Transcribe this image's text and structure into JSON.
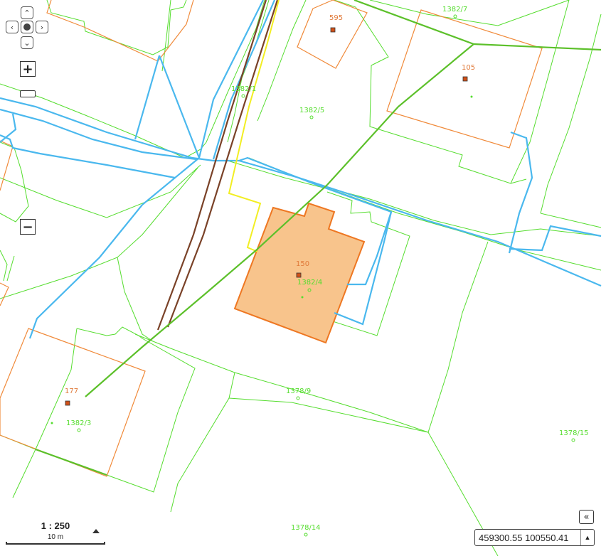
{
  "map": {
    "parcels": [
      {
        "id": "p1",
        "label": "1382/7"
      },
      {
        "id": "p2",
        "label": "1382/1"
      },
      {
        "id": "p3",
        "label": "1382/5"
      },
      {
        "id": "p4",
        "label": "1382/4"
      },
      {
        "id": "p5",
        "label": "1378/9"
      },
      {
        "id": "p6",
        "label": "1382/3"
      },
      {
        "id": "p7",
        "label": "1378/15"
      },
      {
        "id": "p8",
        "label": "1378/14"
      }
    ],
    "buildings": [
      {
        "id": "b1",
        "label": "595"
      },
      {
        "id": "b2",
        "label": "105"
      },
      {
        "id": "b3",
        "label": "150",
        "selected": true
      },
      {
        "id": "b4",
        "label": "177"
      }
    ],
    "colors": {
      "parcel_line": "#55dd2e",
      "building_line": "#f08a3a",
      "selected_fill": "#f8c48c",
      "selected_line": "#ee7722",
      "water_line": "#4ab8ee",
      "rail_line": "#7a4228",
      "boundary_line": "#f2ee22",
      "power_line": "#5cc02a"
    }
  },
  "controls": {
    "pan_up_icon": "up-arrow",
    "pan_left_icon": "left-arrow",
    "pan_center_icon": "home",
    "pan_right_icon": "right-arrow",
    "pan_down_icon": "down-arrow",
    "zoom_in_label": "+",
    "zoom_out_label": "−"
  },
  "scale": {
    "ratio": "1 : 250",
    "distance": "10 m"
  },
  "coordinates": {
    "value": "459300.55 100550.41"
  }
}
